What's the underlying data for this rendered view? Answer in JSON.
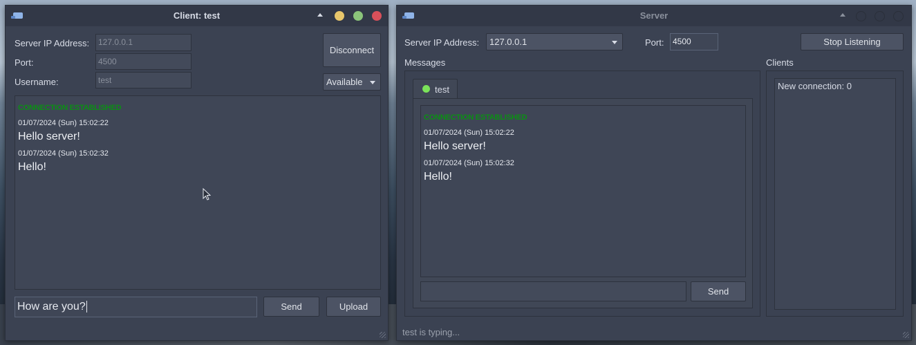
{
  "client": {
    "title": "Client: test",
    "server_ip_label": "Server IP Address:",
    "server_ip_value": "127.0.0.1",
    "port_label": "Port:",
    "port_value": "4500",
    "username_label": "Username:",
    "username_value": "test",
    "disconnect_label": "Disconnect",
    "status_selected": "Available",
    "messages": {
      "status": "CONNECTION ESTABLISHED",
      "items": [
        {
          "timestamp": "01/07/2024 (Sun) 15:02:22",
          "text": "Hello server!"
        },
        {
          "timestamp": "01/07/2024 (Sun) 15:02:32",
          "text": "Hello!"
        }
      ]
    },
    "input_value": "How are you?",
    "send_label": "Send",
    "upload_label": "Upload"
  },
  "server": {
    "title": "Server",
    "server_ip_label": "Server IP Address:",
    "server_ip_value": "127.0.0.1",
    "port_label": "Port:",
    "port_value": "4500",
    "stop_label": "Stop Listening",
    "messages_label": "Messages",
    "clients_label": "Clients",
    "tab_label": "test",
    "messages": {
      "status": "CONNECTION ESTABLISHED",
      "items": [
        {
          "timestamp": "01/07/2024 (Sun) 15:02:22",
          "text": "Hello server!"
        },
        {
          "timestamp": "01/07/2024 (Sun) 15:02:32",
          "text": "Hello!"
        }
      ]
    },
    "input_value": "",
    "send_label": "Send",
    "clients_list": [
      "New connection: 0"
    ],
    "status_bar": "test is typing..."
  },
  "colors": {
    "window_bg": "#3b4252",
    "titlebar_bg": "#323847",
    "connected_green": "#0b8f14",
    "online_dot": "#7be35a",
    "minimize": "#e8c66b",
    "maximize": "#8bc47a",
    "close": "#d9505a"
  },
  "icons": {
    "app": "app-icon",
    "keep_above": "triangle-up-icon",
    "pointer": "mouse-cursor-icon"
  }
}
